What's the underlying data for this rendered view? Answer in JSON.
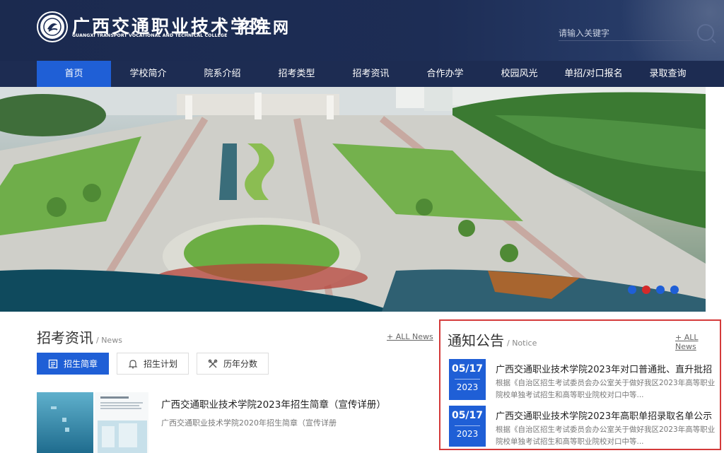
{
  "header": {
    "logo_cn": "广西交通职业技术学院",
    "logo_en": "GUANGXI TRANSPORT VOCATIONAL AND TECHNICAL COLLEGE",
    "site_name": "招生网",
    "search_placeholder": "请输入关键字",
    "search_icon": "search-icon",
    "logo_icon": "college-emblem-icon"
  },
  "nav": {
    "items": [
      {
        "label": "首页"
      },
      {
        "label": "学校简介"
      },
      {
        "label": "院系介绍"
      },
      {
        "label": "招考类型"
      },
      {
        "label": "招考资讯"
      },
      {
        "label": "合作办学"
      },
      {
        "label": "校园风光"
      },
      {
        "label": "单招/对口报名"
      },
      {
        "label": "录取查询"
      }
    ],
    "active_index": 0
  },
  "banner": {
    "slide_count": 4,
    "active_slide": 2
  },
  "news": {
    "title": "招考资讯",
    "subtitle": "/ News",
    "all_link": "+ ALL News",
    "tabs": [
      {
        "label": "招生简章",
        "icon": "document-icon"
      },
      {
        "label": "招生计划",
        "icon": "bell-icon"
      },
      {
        "label": "历年分数",
        "icon": "tools-icon"
      }
    ],
    "active_tab": 0,
    "items": [
      {
        "title": "广西交通职业技术学院2023年招生简章（宣传详册）",
        "subtitle": "广西交通职业技术学院2020年招生简章（宣传详册"
      }
    ]
  },
  "notice": {
    "title": "通知公告",
    "subtitle": "/ Notice",
    "all_link": "+ ALL News",
    "items": [
      {
        "date": "05/17",
        "year": "2023",
        "title": "广西交通职业技术学院2023年对口普通批、直升批招",
        "desc": "根据《自治区招生考试委员会办公室关于做好我区2023年高等职业院校单独考试招生和高等职业院校对口中等..."
      },
      {
        "date": "05/17",
        "year": "2023",
        "title": "广西交通职业技术学院2023年高职单招录取名单公示",
        "desc": "根据《自治区招生考试委员会办公室关于做好我区2023年高等职业院校单独考试招生和高等职业院校对口中等..."
      }
    ]
  },
  "colors": {
    "header_bg": "#1d2d55",
    "accent_blue": "#1f5fd6",
    "highlight_red": "#d43a3a"
  }
}
